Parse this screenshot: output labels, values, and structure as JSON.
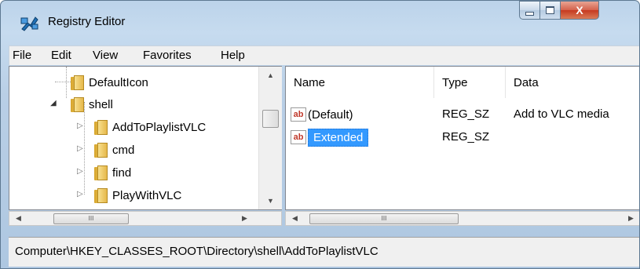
{
  "window": {
    "title": "Registry Editor",
    "buttons": {
      "minimize": "–",
      "maximize": "□",
      "close": "X"
    }
  },
  "menu": {
    "items": [
      {
        "label": "File"
      },
      {
        "label": "Edit"
      },
      {
        "label": "View"
      },
      {
        "label": "Favorites"
      },
      {
        "label": "Help"
      }
    ]
  },
  "tree": {
    "nodes": [
      {
        "label": "DefaultIcon",
        "expander": ""
      },
      {
        "label": "shell",
        "expander": "◢"
      },
      {
        "label": "AddToPlaylistVLC",
        "expander": "▷"
      },
      {
        "label": "cmd",
        "expander": "▷"
      },
      {
        "label": "find",
        "expander": "▷"
      },
      {
        "label": "PlayWithVLC",
        "expander": "▷"
      }
    ],
    "hscroll_thumb": "III"
  },
  "list": {
    "columns": {
      "name": "Name",
      "type": "Type",
      "data": "Data"
    },
    "rows": [
      {
        "icon": "ab",
        "name": "(Default)",
        "type": "REG_SZ",
        "data": "Add to VLC media"
      },
      {
        "icon": "ab",
        "name": "Extended",
        "type": "REG_SZ",
        "data": ""
      }
    ],
    "hscroll_thumb": "III"
  },
  "status": {
    "path": "Computer\\HKEY_CLASSES_ROOT\\Directory\\shell\\AddToPlaylistVLC"
  },
  "colors": {
    "selection": "#3399ff",
    "title_bar": "#c6dbef",
    "close_button": "#c5391f"
  }
}
